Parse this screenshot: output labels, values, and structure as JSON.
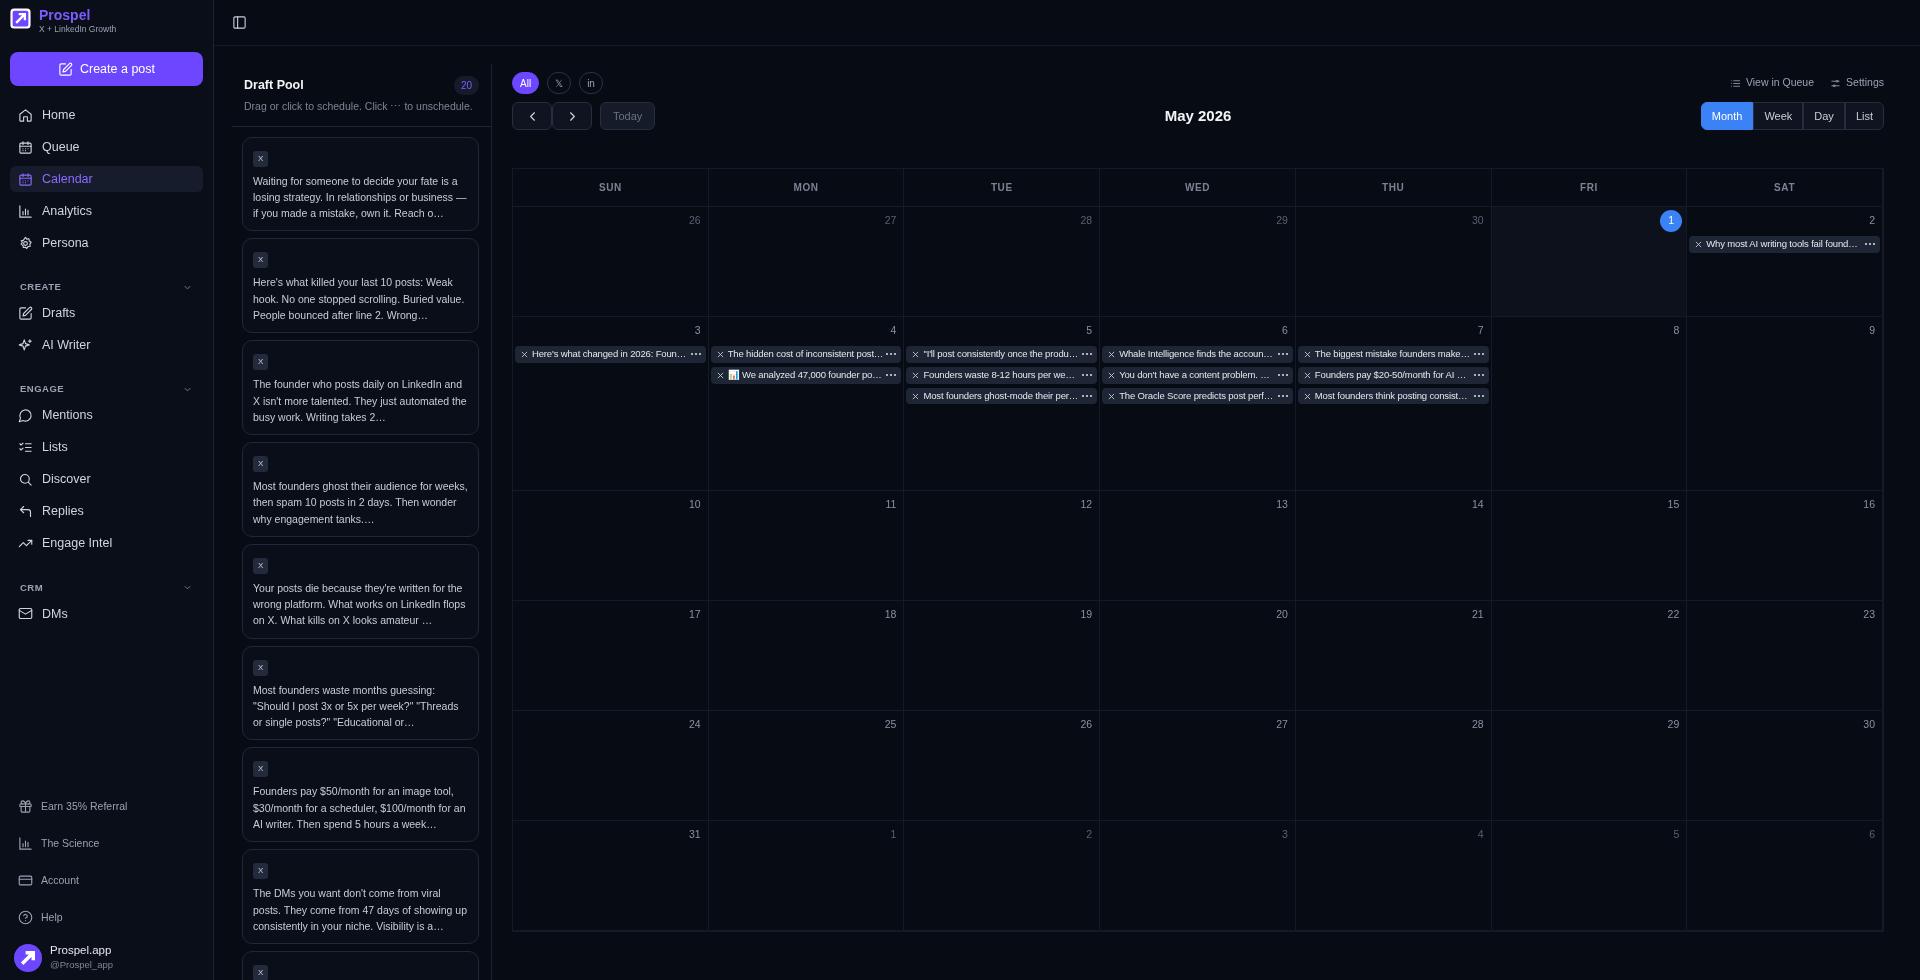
{
  "brand": {
    "name": "Prospel",
    "tagline": "X + LinkedIn Growth"
  },
  "create_button": "Create a post",
  "nav": [
    {
      "label": "Home",
      "selected": false
    },
    {
      "label": "Queue",
      "selected": false
    },
    {
      "label": "Calendar",
      "selected": true
    },
    {
      "label": "Analytics",
      "selected": false
    },
    {
      "label": "Persona",
      "selected": false
    }
  ],
  "sections": [
    {
      "title": "CREATE",
      "expanded": true,
      "items": [
        {
          "label": "Drafts"
        },
        {
          "label": "AI Writer"
        }
      ]
    },
    {
      "title": "ENGAGE",
      "expanded": true,
      "items": [
        {
          "label": "Mentions"
        },
        {
          "label": "Lists"
        },
        {
          "label": "Discover"
        },
        {
          "label": "Replies"
        },
        {
          "label": "Engage Intel"
        }
      ]
    },
    {
      "title": "CRM",
      "expanded": true,
      "items": [
        {
          "label": "DMs"
        }
      ]
    }
  ],
  "footer_links": [
    "Earn 35% Referral",
    "The Science",
    "Account",
    "Help"
  ],
  "user": {
    "name": "Prospel.app",
    "handle": "@Prospel_app"
  },
  "draft_pool": {
    "title": "Draft Pool",
    "count": "20",
    "hint": "Drag or click to schedule. Click ⋯ to unschedule.",
    "drafts": [
      {
        "platform": "X",
        "text": "Waiting for someone to decide your fate is a losing strategy. In relationships or business — if you made a mistake, own it. Reach o…"
      },
      {
        "platform": "X",
        "text": "Here's what killed your last 10 posts: Weak hook. No one stopped scrolling. Buried value. People bounced after line 2. Wrong…"
      },
      {
        "platform": "X",
        "text": "The founder who posts daily on LinkedIn and X isn't more talented. They just automated the busy work. Writing takes 2…"
      },
      {
        "platform": "X",
        "text": "Most founders ghost their audience for weeks, then spam 10 posts in 2 days. Then wonder why engagement tanks.…"
      },
      {
        "platform": "X",
        "text": "Your posts die because they're written for the wrong platform. What works on LinkedIn flops on X. What kills on X looks amateur …"
      },
      {
        "platform": "X",
        "text": "Most founders waste months guessing: \"Should I post 3x or 5x per week?\" \"Threads or single posts?\" \"Educational or…"
      },
      {
        "platform": "X",
        "text": "Founders pay $50/month for an image tool, $30/month for a scheduler, $100/month for an AI writer. Then spend 5 hours a week…"
      },
      {
        "platform": "X",
        "text": "The DMs you want don't come from viral posts. They come from 47 days of showing up consistently in your niche. Visibility is a…"
      },
      {
        "platform": "X"
      }
    ]
  },
  "calendar": {
    "filters": [
      {
        "label": "All",
        "selected": true
      },
      {
        "label": "𝕏",
        "selected": false
      },
      {
        "label": "in",
        "selected": false
      }
    ],
    "links": [
      "View in Queue",
      "Settings"
    ],
    "today_button": {
      "label": "Today",
      "disabled": true
    },
    "title": "May 2026",
    "views": [
      {
        "label": "Month",
        "selected": true
      },
      {
        "label": "Week",
        "selected": false
      },
      {
        "label": "Day",
        "selected": false
      },
      {
        "label": "List",
        "selected": false
      }
    ],
    "weekdays": [
      "SUN",
      "MON",
      "TUE",
      "WED",
      "THU",
      "FRI",
      "SAT"
    ],
    "weeks": [
      [
        {
          "day": "26",
          "muted": true
        },
        {
          "day": "27",
          "muted": true
        },
        {
          "day": "28",
          "muted": true
        },
        {
          "day": "29",
          "muted": true
        },
        {
          "day": "30",
          "muted": true
        },
        {
          "day": "1",
          "today": true
        },
        {
          "day": "2",
          "events": [
            {
              "text": "Why most AI writing tools fail found…"
            }
          ]
        }
      ],
      [
        {
          "day": "3",
          "events": [
            {
              "text": "Here's what changed in 2026: Foun…"
            }
          ]
        },
        {
          "day": "4",
          "events": [
            {
              "text": "The hidden cost of inconsistent post…"
            },
            {
              "text": "📊 We analyzed 47,000 founder po…"
            }
          ]
        },
        {
          "day": "5",
          "events": [
            {
              "text": "\"I'll post consistently once the produ…"
            },
            {
              "text": "Founders waste 8-12 hours per we…"
            },
            {
              "text": "Most founders ghost-mode their per…"
            }
          ]
        },
        {
          "day": "6",
          "events": [
            {
              "text": "Whale Intelligence finds the accoun…"
            },
            {
              "text": "You don't have a content problem. …"
            },
            {
              "text": "The Oracle Score predicts post perf…"
            }
          ]
        },
        {
          "day": "7",
          "events": [
            {
              "text": "The biggest mistake founders make…"
            },
            {
              "text": "Founders pay $20-50/month for AI …"
            },
            {
              "text": "Most founders think posting consist…"
            }
          ]
        },
        {
          "day": "8"
        },
        {
          "day": "9"
        }
      ],
      [
        {
          "day": "10"
        },
        {
          "day": "11"
        },
        {
          "day": "12"
        },
        {
          "day": "13"
        },
        {
          "day": "14"
        },
        {
          "day": "15"
        },
        {
          "day": "16"
        }
      ],
      [
        {
          "day": "17"
        },
        {
          "day": "18"
        },
        {
          "day": "19"
        },
        {
          "day": "20"
        },
        {
          "day": "21"
        },
        {
          "day": "22"
        },
        {
          "day": "23"
        }
      ],
      [
        {
          "day": "24"
        },
        {
          "day": "25"
        },
        {
          "day": "26"
        },
        {
          "day": "27"
        },
        {
          "day": "28"
        },
        {
          "day": "29"
        },
        {
          "day": "30"
        }
      ],
      [
        {
          "day": "31"
        },
        {
          "day": "1",
          "muted": true
        },
        {
          "day": "2",
          "muted": true
        },
        {
          "day": "3",
          "muted": true
        },
        {
          "day": "4",
          "muted": true
        },
        {
          "day": "5",
          "muted": true
        },
        {
          "day": "6",
          "muted": true
        }
      ]
    ]
  }
}
